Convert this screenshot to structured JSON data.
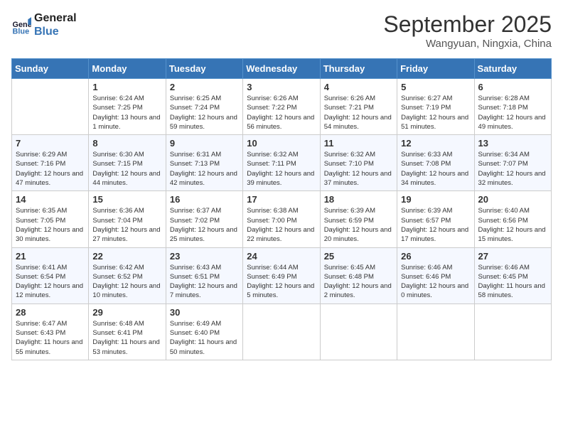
{
  "header": {
    "logo_line1": "General",
    "logo_line2": "Blue",
    "month": "September 2025",
    "location": "Wangyuan, Ningxia, China"
  },
  "weekdays": [
    "Sunday",
    "Monday",
    "Tuesday",
    "Wednesday",
    "Thursday",
    "Friday",
    "Saturday"
  ],
  "weeks": [
    [
      {
        "day": "",
        "sunrise": "",
        "sunset": "",
        "daylight": ""
      },
      {
        "day": "1",
        "sunrise": "Sunrise: 6:24 AM",
        "sunset": "Sunset: 7:25 PM",
        "daylight": "Daylight: 13 hours and 1 minute."
      },
      {
        "day": "2",
        "sunrise": "Sunrise: 6:25 AM",
        "sunset": "Sunset: 7:24 PM",
        "daylight": "Daylight: 12 hours and 59 minutes."
      },
      {
        "day": "3",
        "sunrise": "Sunrise: 6:26 AM",
        "sunset": "Sunset: 7:22 PM",
        "daylight": "Daylight: 12 hours and 56 minutes."
      },
      {
        "day": "4",
        "sunrise": "Sunrise: 6:26 AM",
        "sunset": "Sunset: 7:21 PM",
        "daylight": "Daylight: 12 hours and 54 minutes."
      },
      {
        "day": "5",
        "sunrise": "Sunrise: 6:27 AM",
        "sunset": "Sunset: 7:19 PM",
        "daylight": "Daylight: 12 hours and 51 minutes."
      },
      {
        "day": "6",
        "sunrise": "Sunrise: 6:28 AM",
        "sunset": "Sunset: 7:18 PM",
        "daylight": "Daylight: 12 hours and 49 minutes."
      }
    ],
    [
      {
        "day": "7",
        "sunrise": "Sunrise: 6:29 AM",
        "sunset": "Sunset: 7:16 PM",
        "daylight": "Daylight: 12 hours and 47 minutes."
      },
      {
        "day": "8",
        "sunrise": "Sunrise: 6:30 AM",
        "sunset": "Sunset: 7:15 PM",
        "daylight": "Daylight: 12 hours and 44 minutes."
      },
      {
        "day": "9",
        "sunrise": "Sunrise: 6:31 AM",
        "sunset": "Sunset: 7:13 PM",
        "daylight": "Daylight: 12 hours and 42 minutes."
      },
      {
        "day": "10",
        "sunrise": "Sunrise: 6:32 AM",
        "sunset": "Sunset: 7:11 PM",
        "daylight": "Daylight: 12 hours and 39 minutes."
      },
      {
        "day": "11",
        "sunrise": "Sunrise: 6:32 AM",
        "sunset": "Sunset: 7:10 PM",
        "daylight": "Daylight: 12 hours and 37 minutes."
      },
      {
        "day": "12",
        "sunrise": "Sunrise: 6:33 AM",
        "sunset": "Sunset: 7:08 PM",
        "daylight": "Daylight: 12 hours and 34 minutes."
      },
      {
        "day": "13",
        "sunrise": "Sunrise: 6:34 AM",
        "sunset": "Sunset: 7:07 PM",
        "daylight": "Daylight: 12 hours and 32 minutes."
      }
    ],
    [
      {
        "day": "14",
        "sunrise": "Sunrise: 6:35 AM",
        "sunset": "Sunset: 7:05 PM",
        "daylight": "Daylight: 12 hours and 30 minutes."
      },
      {
        "day": "15",
        "sunrise": "Sunrise: 6:36 AM",
        "sunset": "Sunset: 7:04 PM",
        "daylight": "Daylight: 12 hours and 27 minutes."
      },
      {
        "day": "16",
        "sunrise": "Sunrise: 6:37 AM",
        "sunset": "Sunset: 7:02 PM",
        "daylight": "Daylight: 12 hours and 25 minutes."
      },
      {
        "day": "17",
        "sunrise": "Sunrise: 6:38 AM",
        "sunset": "Sunset: 7:00 PM",
        "daylight": "Daylight: 12 hours and 22 minutes."
      },
      {
        "day": "18",
        "sunrise": "Sunrise: 6:39 AM",
        "sunset": "Sunset: 6:59 PM",
        "daylight": "Daylight: 12 hours and 20 minutes."
      },
      {
        "day": "19",
        "sunrise": "Sunrise: 6:39 AM",
        "sunset": "Sunset: 6:57 PM",
        "daylight": "Daylight: 12 hours and 17 minutes."
      },
      {
        "day": "20",
        "sunrise": "Sunrise: 6:40 AM",
        "sunset": "Sunset: 6:56 PM",
        "daylight": "Daylight: 12 hours and 15 minutes."
      }
    ],
    [
      {
        "day": "21",
        "sunrise": "Sunrise: 6:41 AM",
        "sunset": "Sunset: 6:54 PM",
        "daylight": "Daylight: 12 hours and 12 minutes."
      },
      {
        "day": "22",
        "sunrise": "Sunrise: 6:42 AM",
        "sunset": "Sunset: 6:52 PM",
        "daylight": "Daylight: 12 hours and 10 minutes."
      },
      {
        "day": "23",
        "sunrise": "Sunrise: 6:43 AM",
        "sunset": "Sunset: 6:51 PM",
        "daylight": "Daylight: 12 hours and 7 minutes."
      },
      {
        "day": "24",
        "sunrise": "Sunrise: 6:44 AM",
        "sunset": "Sunset: 6:49 PM",
        "daylight": "Daylight: 12 hours and 5 minutes."
      },
      {
        "day": "25",
        "sunrise": "Sunrise: 6:45 AM",
        "sunset": "Sunset: 6:48 PM",
        "daylight": "Daylight: 12 hours and 2 minutes."
      },
      {
        "day": "26",
        "sunrise": "Sunrise: 6:46 AM",
        "sunset": "Sunset: 6:46 PM",
        "daylight": "Daylight: 12 hours and 0 minutes."
      },
      {
        "day": "27",
        "sunrise": "Sunrise: 6:46 AM",
        "sunset": "Sunset: 6:45 PM",
        "daylight": "Daylight: 11 hours and 58 minutes."
      }
    ],
    [
      {
        "day": "28",
        "sunrise": "Sunrise: 6:47 AM",
        "sunset": "Sunset: 6:43 PM",
        "daylight": "Daylight: 11 hours and 55 minutes."
      },
      {
        "day": "29",
        "sunrise": "Sunrise: 6:48 AM",
        "sunset": "Sunset: 6:41 PM",
        "daylight": "Daylight: 11 hours and 53 minutes."
      },
      {
        "day": "30",
        "sunrise": "Sunrise: 6:49 AM",
        "sunset": "Sunset: 6:40 PM",
        "daylight": "Daylight: 11 hours and 50 minutes."
      },
      {
        "day": "",
        "sunrise": "",
        "sunset": "",
        "daylight": ""
      },
      {
        "day": "",
        "sunrise": "",
        "sunset": "",
        "daylight": ""
      },
      {
        "day": "",
        "sunrise": "",
        "sunset": "",
        "daylight": ""
      },
      {
        "day": "",
        "sunrise": "",
        "sunset": "",
        "daylight": ""
      }
    ]
  ]
}
